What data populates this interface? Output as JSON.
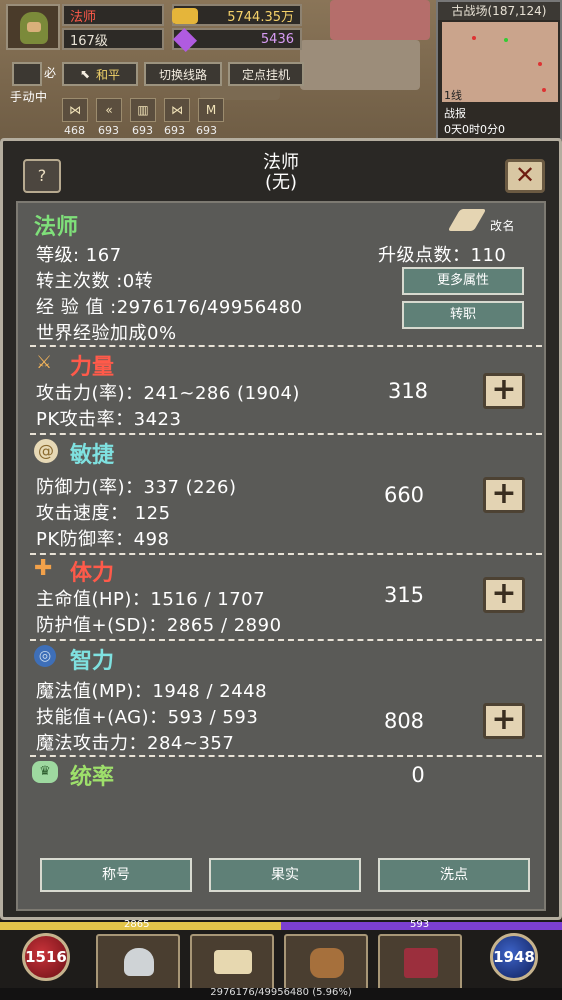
{
  "top": {
    "player_name": "法师",
    "level": "167级",
    "gold": "5744.35万",
    "gems": "5436",
    "mode_button": "和平",
    "switch_line_button": "切换线路",
    "auto_hang_button": "定点挂机",
    "manual_label": "手动中",
    "skill_counts": [
      "468",
      "693",
      "693",
      "693",
      "693"
    ]
  },
  "minimap": {
    "title": "古战场(187,124)",
    "line": "1线",
    "battle_report": "战报",
    "timer": "0天0时0分0"
  },
  "panel": {
    "title": "法师",
    "subtitle": "(无)",
    "help": "?",
    "close": "✕"
  },
  "profile": {
    "class_name": "法师",
    "rename": "改名",
    "level_line": "等级: 167",
    "upgrade_points": "升级点数：110",
    "rebirth": "转主次数 :0转",
    "exp": "经 验 值 :2976176/49956480",
    "world_exp": "世界经验加成0%",
    "more_attrs_button": "更多属性",
    "change_job_button": "转职"
  },
  "strength": {
    "title": "力量",
    "attack": "攻击力(率)：241~286 (1904)",
    "pk_attack": "PK攻击率：3423",
    "value": "318"
  },
  "agility": {
    "title": "敏捷",
    "defense": "防御力(率)：337 (226)",
    "attack_speed": "攻击速度： 125",
    "pk_defense": "PK防御率：498",
    "value": "660"
  },
  "stamina": {
    "title": "体力",
    "hp": "主命值(HP)：1516 / 1707",
    "sd": "防护值+(SD)：2865 / 2890",
    "value": "315"
  },
  "intelligence": {
    "title": "智力",
    "mp": "魔法值(MP)：1948 / 2448",
    "ag": "技能值+(AG)：593 / 593",
    "magic_attack": "魔法攻击力：284~357",
    "value": "808"
  },
  "command": {
    "title": "统率",
    "value": "0"
  },
  "bottom_buttons": [
    "称号",
    "果实",
    "洗点"
  ],
  "hud": {
    "sd_value": "2865",
    "ag_value": "593",
    "hp_orb": "1516",
    "mp_orb": "1948",
    "exp_text": "2976176/49956480 (5.96%)"
  },
  "colors": {
    "strength": "#ff5a4a",
    "agility": "#7fe1e0",
    "stamina": "#ff5a4a",
    "intelligence": "#7fe1e0",
    "command": "#9ee06b",
    "class_name": "#7fe07a"
  }
}
